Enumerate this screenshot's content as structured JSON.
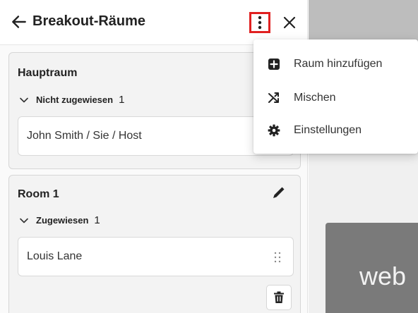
{
  "header": {
    "title": "Breakout-Räume"
  },
  "rooms": {
    "main": {
      "title": "Hauptraum",
      "group_label": "Nicht zugewiesen",
      "group_count": "1",
      "members": [
        "John Smith / Sie / Host"
      ]
    },
    "room1": {
      "title": "Room 1",
      "group_label": "Zugewiesen",
      "group_count": "1",
      "members": [
        "Louis Lane"
      ]
    }
  },
  "menu": {
    "items": [
      {
        "label": "Raum hinzufügen",
        "icon": "plus-square-icon"
      },
      {
        "label": "Mischen",
        "icon": "shuffle-icon"
      },
      {
        "label": "Einstellungen",
        "icon": "gear-icon"
      }
    ]
  },
  "stage": {
    "tile_text": "web"
  },
  "colors": {
    "highlight": "#e02020",
    "tile": "#7a7a7a"
  }
}
